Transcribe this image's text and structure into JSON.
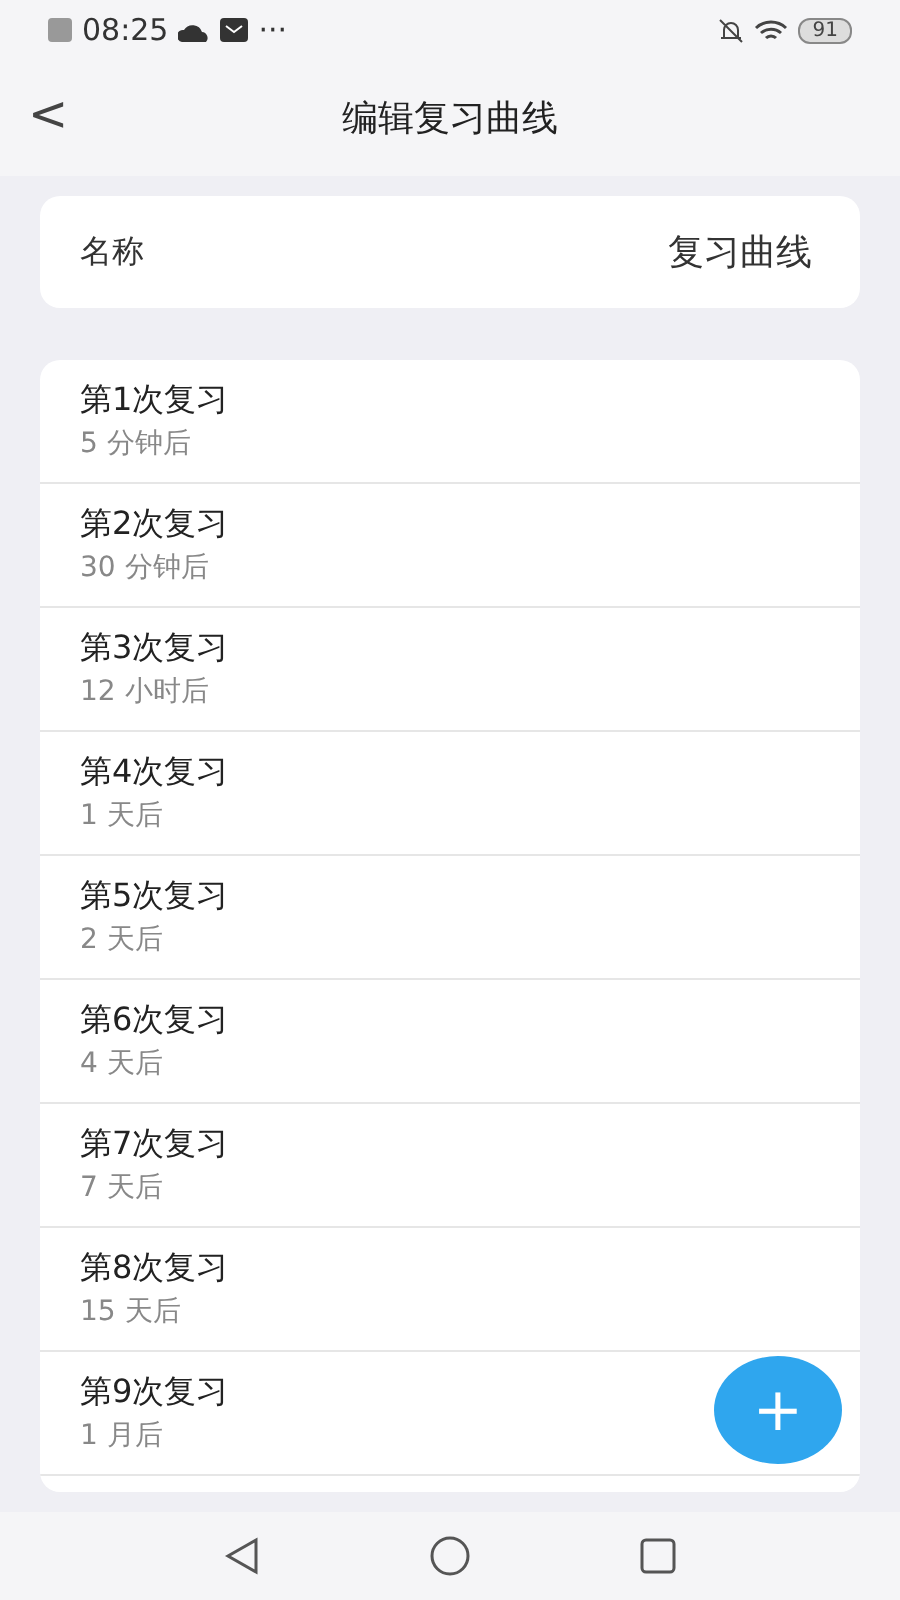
{
  "status_bar": {
    "time": "08:25",
    "more": "···",
    "battery": "91"
  },
  "header": {
    "back": "<",
    "title": "编辑复习曲线"
  },
  "name_field": {
    "label": "名称",
    "value": "复习曲线"
  },
  "reviews": [
    {
      "title": "第1次复习",
      "interval": "5 分钟后"
    },
    {
      "title": "第2次复习",
      "interval": "30 分钟后"
    },
    {
      "title": "第3次复习",
      "interval": "12 小时后"
    },
    {
      "title": "第4次复习",
      "interval": "1 天后"
    },
    {
      "title": "第5次复习",
      "interval": "2 天后"
    },
    {
      "title": "第6次复习",
      "interval": "4 天后"
    },
    {
      "title": "第7次复习",
      "interval": "7 天后"
    },
    {
      "title": "第8次复习",
      "interval": "15 天后"
    },
    {
      "title": "第9次复习",
      "interval": "1 月后"
    }
  ],
  "fab": "+"
}
